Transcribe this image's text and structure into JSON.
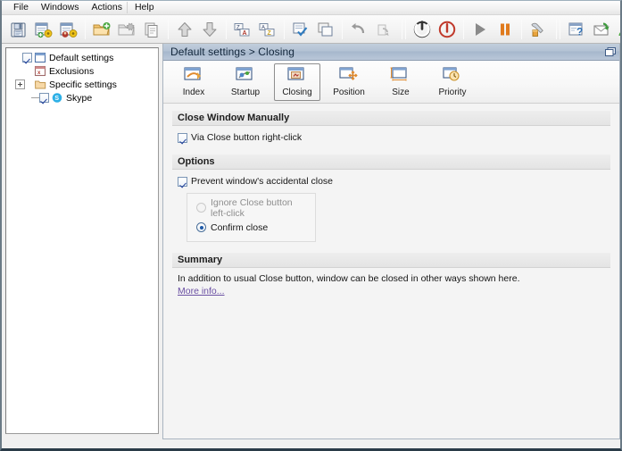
{
  "window": {
    "title_icon": "restore-window-icon"
  },
  "menubar": {
    "items": [
      {
        "label": "File",
        "name": "menu-file"
      },
      {
        "label": "Windows",
        "name": "menu-windows"
      },
      {
        "label": "Actions",
        "name": "menu-actions"
      },
      {
        "label": "Help",
        "name": "menu-help"
      }
    ]
  },
  "toolbar": {
    "buttons": [
      {
        "icon": "save-icon",
        "tooltip": "Save"
      },
      {
        "icon": "add-settings-icon",
        "tooltip": "Add settings"
      },
      {
        "icon": "edit-settings-icon",
        "tooltip": "Edit settings"
      },
      {
        "icon": "new-folder-icon",
        "tooltip": "New"
      },
      {
        "icon": "delete-folder-icon",
        "tooltip": "Delete"
      },
      {
        "icon": "copy-icon",
        "tooltip": "Copy"
      },
      {
        "icon": "move-up-icon",
        "tooltip": "Move up"
      },
      {
        "icon": "move-down-icon",
        "tooltip": "Move down"
      },
      {
        "icon": "sort-az-icon",
        "tooltip": "Sort ascending"
      },
      {
        "icon": "sort-za-icon",
        "tooltip": "Sort descending"
      },
      {
        "icon": "check-all-icon",
        "tooltip": "Check all"
      },
      {
        "icon": "uncheck-all-icon",
        "tooltip": "Uncheck all"
      },
      {
        "icon": "undo-icon",
        "tooltip": "Undo"
      },
      {
        "icon": "redo-icon",
        "tooltip": "Redo"
      },
      {
        "icon": "power-icon",
        "tooltip": "Enable"
      },
      {
        "icon": "power-off-icon",
        "tooltip": "Disable"
      },
      {
        "icon": "play-icon",
        "tooltip": "Run"
      },
      {
        "icon": "pause-icon",
        "tooltip": "Pause"
      },
      {
        "icon": "tools-icon",
        "tooltip": "Tools"
      },
      {
        "icon": "help-icon",
        "tooltip": "Help"
      },
      {
        "icon": "mail-icon",
        "tooltip": "Feedback"
      },
      {
        "icon": "support-icon",
        "tooltip": "Support"
      }
    ]
  },
  "tree": {
    "items": [
      {
        "label": "Default settings",
        "icon": "settings-window-icon",
        "checked": true,
        "level": 1,
        "expander": false
      },
      {
        "label": "Exclusions",
        "icon": "exclusions-icon",
        "checked": null,
        "level": 1,
        "expander": false
      },
      {
        "label": "Specific settings",
        "icon": "specific-settings-icon",
        "checked": null,
        "level": 1,
        "expander": true
      },
      {
        "label": "Skype",
        "icon": "skype-icon",
        "checked": true,
        "level": 2,
        "expander": false
      }
    ]
  },
  "content": {
    "title": "Default settings > Closing",
    "tabs": [
      {
        "label": "Index",
        "icon": "index-icon",
        "selected": false
      },
      {
        "label": "Startup",
        "icon": "startup-icon",
        "selected": false
      },
      {
        "label": "Closing",
        "icon": "closing-icon",
        "selected": true
      },
      {
        "label": "Position",
        "icon": "position-icon",
        "selected": false
      },
      {
        "label": "Size",
        "icon": "size-icon",
        "selected": false
      },
      {
        "label": "Priority",
        "icon": "priority-icon",
        "selected": false
      }
    ],
    "sections": {
      "close_manually": {
        "heading": "Close Window Manually",
        "checkbox_label": "Via Close button right-click",
        "checked": true
      },
      "options": {
        "heading": "Options",
        "checkbox_label": "Prevent window's accidental close",
        "checked": true,
        "radios": [
          {
            "label": "Ignore Close button left-click",
            "selected": false,
            "disabled": true
          },
          {
            "label": "Confirm close",
            "selected": true,
            "disabled": false
          }
        ]
      },
      "summary": {
        "heading": "Summary",
        "text": "In addition to usual Close button, window can be closed in other ways shown here.",
        "link": "More info..."
      }
    }
  },
  "colors": {
    "title_bar": "#b3c2d4",
    "accent_link": "#6a4fa3",
    "panel_bg": "#f4f4f4"
  }
}
